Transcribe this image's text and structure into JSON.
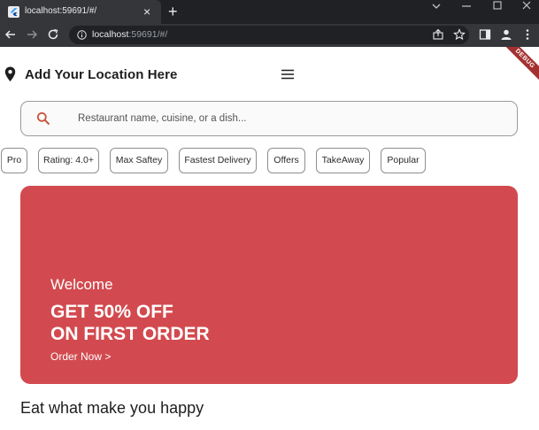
{
  "browser": {
    "tab_title": "localhost:59691/#/",
    "new_tab_symbol": "+",
    "close_symbol": "×",
    "url_host": "localhost",
    "url_rest": ":59691/#/"
  },
  "app": {
    "debug_label": "DEBUG",
    "location_title": "Add Your Location Here",
    "search_placeholder": "Restaurant name, cuisine, or a dish...",
    "filters": [
      "Pro",
      "Rating: 4.0+",
      "Max Saftey",
      "Fastest Delivery",
      "Offers",
      "TakeAway",
      "Popular"
    ],
    "banner": {
      "welcome": "Welcome",
      "headline_line1": "GET 50% OFF",
      "headline_line2": "ON FIRST ORDER",
      "cta": "Order Now >"
    },
    "section_title": "Eat what make you happy"
  },
  "colors": {
    "brand_red": "#d24a4f",
    "search_icon": "#c8553d",
    "chrome_dark": "#202124",
    "chrome_tab": "#35363a"
  },
  "icons": [
    "flutter-favicon-icon",
    "back-arrow-icon",
    "forward-arrow-icon",
    "reload-icon",
    "info-icon",
    "share-icon",
    "star-icon",
    "side-panel-icon",
    "profile-icon",
    "kebab-menu-icon",
    "location-pin-icon",
    "hamburger-menu-icon",
    "search-icon"
  ]
}
